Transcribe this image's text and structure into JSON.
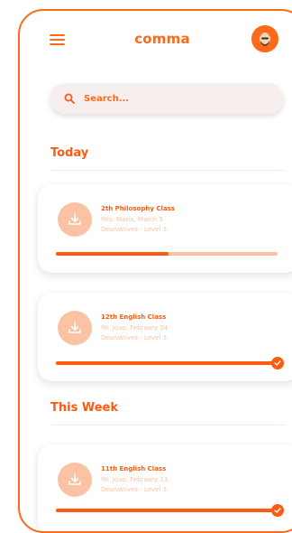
{
  "app": {
    "title": "comma"
  },
  "search": {
    "placeholder": "Search..."
  },
  "sections": [
    {
      "title": "Today"
    },
    {
      "title": "This Week"
    }
  ],
  "classes": [
    {
      "title": "2th Philosophy Class",
      "teacher_date": "Mrs. Maria, March 5",
      "topic": "Devivatives - Level 3",
      "progress": 0.51,
      "completed": false
    },
    {
      "title": "12th English Class",
      "teacher_date": "Mr. Joao, February 24",
      "topic": "Devivatives - Level 3",
      "progress": 1.0,
      "completed": true
    },
    {
      "title": "11th English Class",
      "teacher_date": "Mr. Joao, February 13",
      "topic": "Devivatives - Level 3",
      "progress": 1.0,
      "completed": true
    }
  ],
  "icons": {
    "menu": "hamburger-menu-icon",
    "search": "search-icon",
    "download": "download-icon",
    "check": "check-icon"
  },
  "colors": {
    "accent": "#ff5a12",
    "accent_light": "#fbc2a4",
    "search_bg": "#f7efee",
    "frame": "#ff6a1a"
  }
}
